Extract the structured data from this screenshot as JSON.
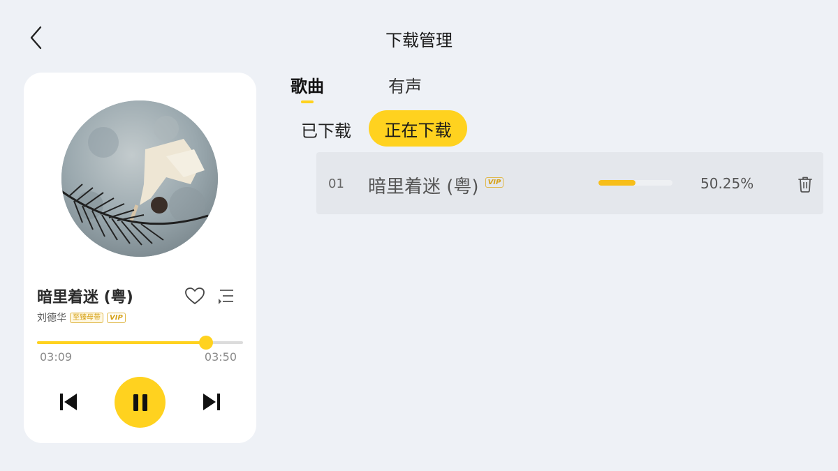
{
  "header": {
    "title": "下载管理",
    "back_icon": "chevron-left-icon"
  },
  "player": {
    "song_title": "暗里着迷 (粤)",
    "artist": "刘德华",
    "badges": {
      "quality": "至臻母带",
      "vip": "VIP"
    },
    "current_time": "03:09",
    "total_time": "03:50",
    "progress": 0.82,
    "icons": {
      "like": "heart-icon",
      "playlist": "playlist-icon",
      "prev": "skip-previous-icon",
      "play_pause": "pause-icon",
      "next": "skip-next-icon"
    }
  },
  "tabs": {
    "songs": "歌曲",
    "audio": "有声",
    "active": "songs"
  },
  "subtabs": {
    "downloaded": "已下载",
    "downloading": "正在下载",
    "active": "downloading"
  },
  "downloads": [
    {
      "index": "01",
      "title": "暗里着迷 (粤)",
      "badge": "VIP",
      "progress": 0.5025,
      "percent_text": "50.25%",
      "delete_icon": "trash-icon"
    }
  ],
  "colors": {
    "accent": "#ffd21f",
    "progress": "#f7be1a",
    "background": "#eef1f6",
    "card": "#ffffff"
  }
}
